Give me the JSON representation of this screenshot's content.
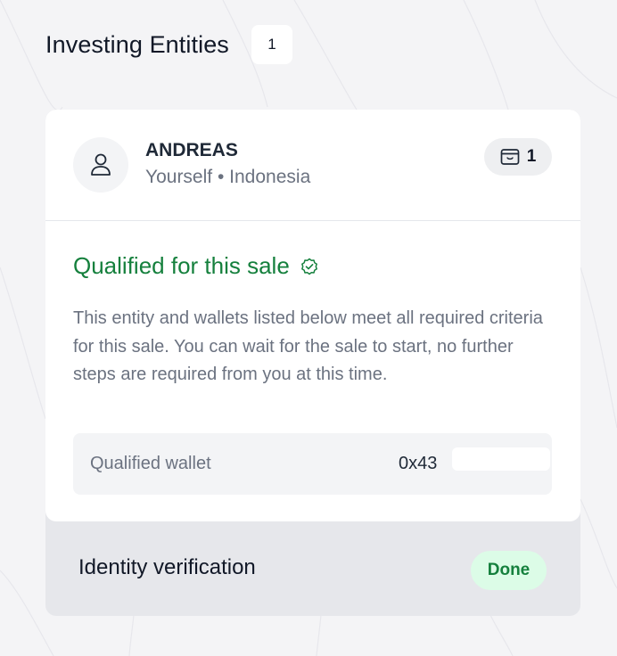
{
  "header": {
    "title": "Investing Entities",
    "count": "1"
  },
  "entity": {
    "name": "ANDREAS",
    "relation": "Yourself",
    "separator": "•",
    "country": "Indonesia",
    "wallet_count": "1",
    "avatar_icon": "user-icon",
    "wallet_icon": "wallet-icon"
  },
  "qualification": {
    "title": "Qualified for this sale",
    "status_icon": "check-circle-icon",
    "description": "This entity and wallets listed below meet all required criteria for this sale. You can wait for the sale to start, no further steps are required from you at this time.",
    "wallet_label": "Qualified wallet",
    "wallet_address": "0x43"
  },
  "identity": {
    "label": "Identity verification",
    "status": "Done"
  },
  "colors": {
    "qualified_green": "#15803d",
    "done_badge_bg": "#dcfce7",
    "page_bg": "#f4f4f6"
  }
}
